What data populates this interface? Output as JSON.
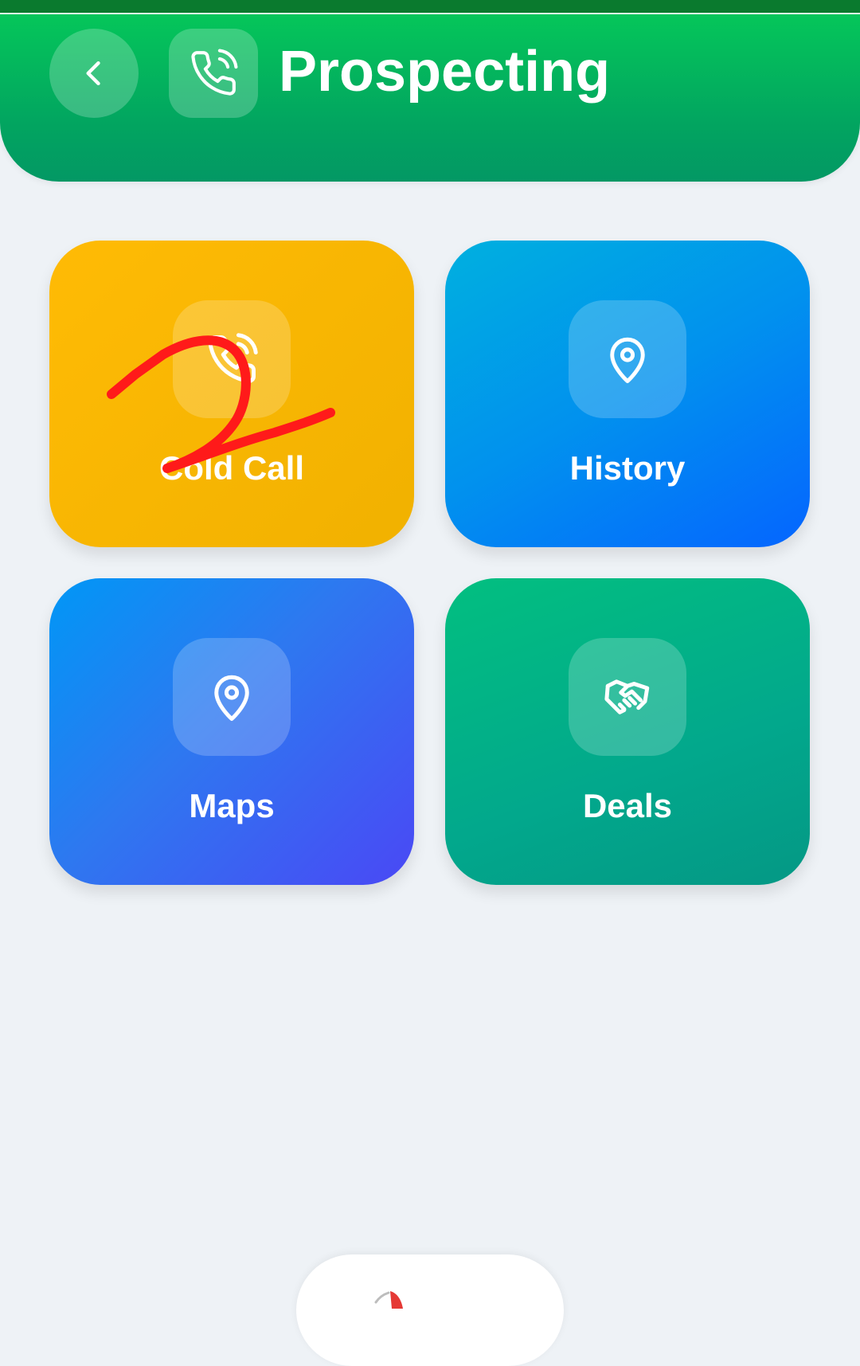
{
  "header": {
    "title": "Prospecting",
    "back_icon": "chevron-left-icon",
    "title_icon": "phone-call-icon",
    "color_top": "#05c65a",
    "color_bottom": "#039864"
  },
  "tiles": [
    {
      "label": "Cold Call",
      "icon": "phone-call-icon",
      "color": "#ffbb05"
    },
    {
      "label": "History",
      "icon": "map-pin-icon",
      "color": "#0191ee"
    },
    {
      "label": "Maps",
      "icon": "map-pin-icon",
      "color": "#2e78f0"
    },
    {
      "label": "Deals",
      "icon": "handshake-icon",
      "color": "#02a88c"
    }
  ],
  "annotation": {
    "text": "2",
    "color": "#ff1a1a"
  },
  "bottom_nav": {
    "icon": "partial-icon"
  },
  "background": "#eef2f6"
}
